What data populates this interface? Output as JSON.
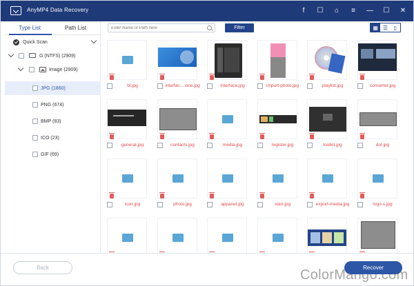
{
  "app": {
    "title": "AnyMP4 Data Recovery"
  },
  "titlebar_icons": [
    {
      "name": "facebook-icon",
      "glyph": "f"
    },
    {
      "name": "chat-icon",
      "glyph": "☐"
    },
    {
      "name": "key-icon",
      "glyph": "⌂"
    },
    {
      "name": "menu-icon",
      "glyph": "≡"
    },
    {
      "name": "minimize-icon",
      "glyph": "—"
    },
    {
      "name": "maximize-icon",
      "glyph": "☐"
    },
    {
      "name": "close-icon",
      "glyph": "✕"
    }
  ],
  "tabs": {
    "type_list": "Type List",
    "path_list": "Path List"
  },
  "tree": {
    "quick_scan": "Quick Scan",
    "drive": "G:(NTFS) (2909)",
    "image": "Image (2909)",
    "types": [
      "JPG (1860)",
      "PNG (674)",
      "BMP (83)",
      "ICO (23)",
      "GIF (69)"
    ]
  },
  "toolbar": {
    "search_placeholder": "Enter Name or Path here",
    "filter_label": "Filter"
  },
  "files": [
    "bl.jpg",
    "interfac....vice.jpg",
    "interface.jpg",
    "import-photo.jpg",
    "playlist.jpg",
    "converter.jpg",
    "general.jpg",
    "contacts.jpg",
    "media.jpg",
    "register.jpg",
    "toolkit.jpg",
    "dot.jpg",
    "icon.jpg",
    "photo.jpg",
    "appareil.jpg",
    "start.jpg",
    "export-media.jpg",
    "logo-s.jpg",
    "",
    "",
    "",
    "",
    "",
    ""
  ],
  "thumb_kinds": [
    "placeholder",
    "blue-wave",
    "phone-app",
    "pink-phone",
    "disc",
    "dark-ui",
    "dark-banner",
    "gray-box",
    "placeholder",
    "register-banner",
    "dark-dialog",
    "gray-bar",
    "placeholder",
    "placeholder",
    "placeholder",
    "placeholder",
    "placeholder",
    "placeholder",
    "placeholder",
    "placeholder",
    "placeholder",
    "placeholder",
    "photos-strip",
    "gray-square"
  ],
  "buttons": {
    "back": "Back",
    "recover": "Recover"
  },
  "watermark": {
    "text": "ColorMango.com"
  },
  "colors": {
    "titlebar": "#1f3a78",
    "accent": "#2d56a6",
    "filename": "#e14a4a"
  }
}
